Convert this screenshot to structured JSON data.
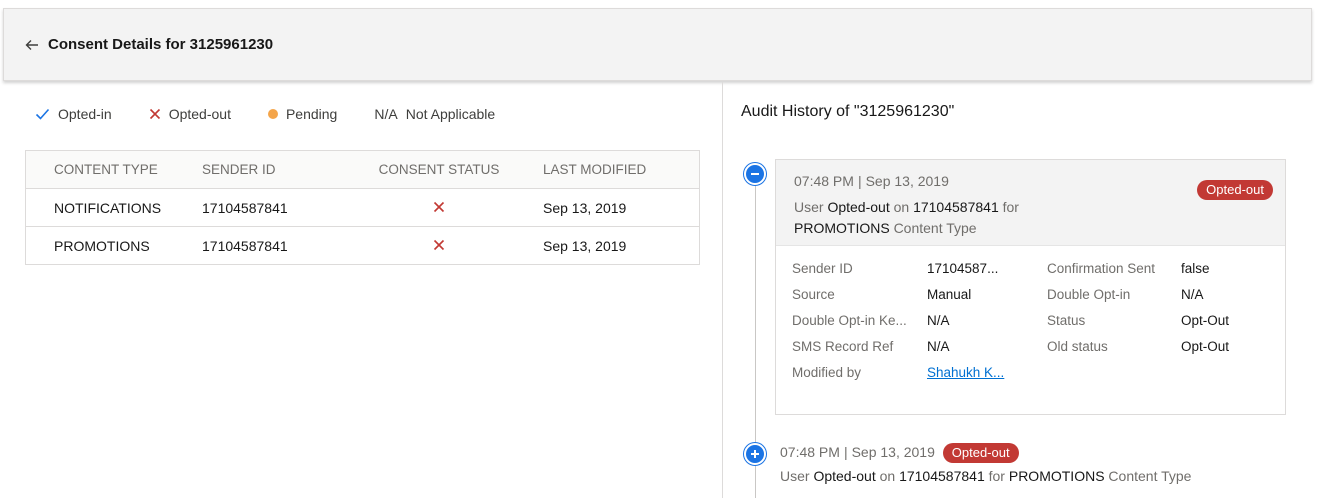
{
  "header": {
    "title": "Consent Details for 3125961230"
  },
  "legend": {
    "opted_in": "Opted-in",
    "opted_out": "Opted-out",
    "pending": "Pending",
    "na_code": "N/A",
    "na_label": "Not Applicable"
  },
  "table": {
    "columns": [
      "CONTENT TYPE",
      "SENDER ID",
      "CONSENT STATUS",
      "LAST MODIFIED"
    ],
    "rows": [
      {
        "content_type": "NOTIFICATIONS",
        "sender_id": "17104587841",
        "last_modified": "Sep 13, 2019"
      },
      {
        "content_type": "PROMOTIONS",
        "sender_id": "17104587841",
        "last_modified": "Sep 13, 2019"
      }
    ]
  },
  "audit": {
    "title": "Audit History of \"3125961230\"",
    "entries": [
      {
        "time": "07:48 PM",
        "sep": "|",
        "date": "Sep 13, 2019",
        "badge": "Opted-out",
        "w_user": "User",
        "w_action": "Opted-out",
        "w_on": "on",
        "w_sender": "17104587841",
        "w_for": "for",
        "w_type": "PROMOTIONS",
        "w_content_type": "Content Type",
        "details": {
          "sender_id_label": "Sender ID",
          "sender_id_value": "17104587...",
          "confirmation_label": "Confirmation Sent",
          "confirmation_value": "false",
          "source_label": "Source",
          "source_value": "Manual",
          "double_optin_label": "Double Opt-in",
          "double_optin_value": "N/A",
          "double_optin_key_label": "Double Opt-in Ke...",
          "double_optin_key_value": "N/A",
          "status_label": "Status",
          "status_value": "Opt-Out",
          "sms_ref_label": "SMS Record Ref",
          "sms_ref_value": "N/A",
          "old_status_label": "Old status",
          "old_status_value": "Opt-Out",
          "modified_by_label": "Modified by",
          "modified_by_value": "Shahukh K..."
        }
      },
      {
        "time": "07:48 PM",
        "sep": "|",
        "date": "Sep 13, 2019",
        "badge": "Opted-out",
        "w_user": "User",
        "w_action": "Opted-out",
        "w_on": "on",
        "w_sender": "17104587841",
        "w_for": "for",
        "w_type": "PROMOTIONS",
        "w_content_type": "Content Type"
      }
    ]
  },
  "colors": {
    "accent": "#1b74e4",
    "danger": "#c23934",
    "pending": "#f4a54a",
    "link": "#0070d2"
  }
}
